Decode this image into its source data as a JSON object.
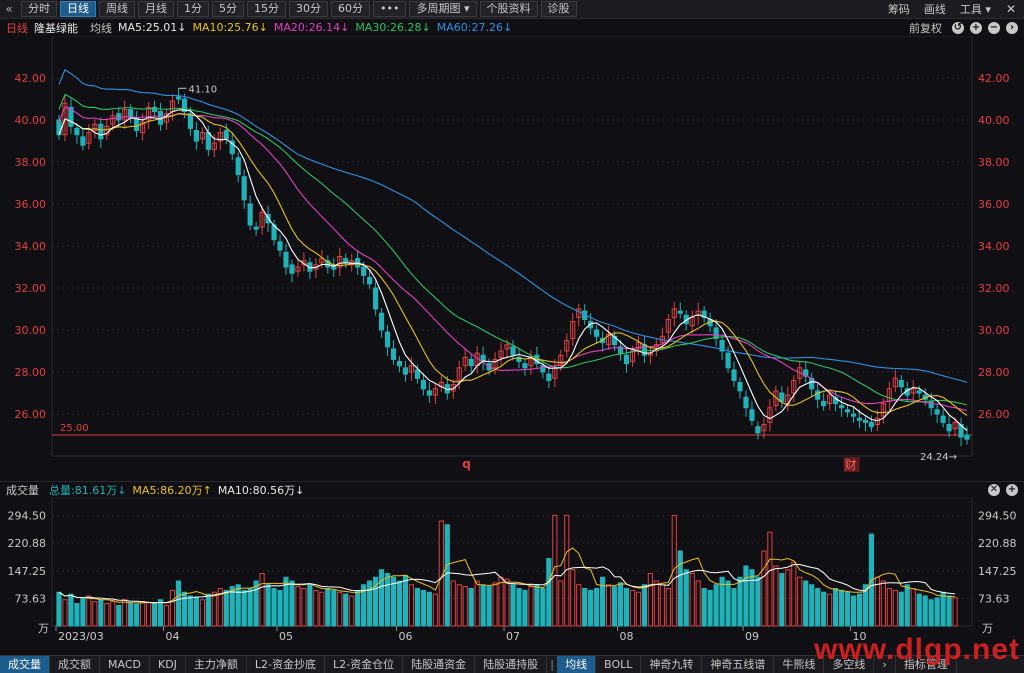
{
  "toolbar": {
    "back_icon": "«",
    "periods": [
      "分时",
      "日线",
      "周线",
      "月线",
      "1分",
      "5分",
      "15分",
      "30分",
      "60分",
      "•••",
      "多周期图 ▾",
      "个股资料",
      "诊股"
    ],
    "active_period": "日线",
    "right": [
      "筹码",
      "画线",
      "工具 ▾"
    ],
    "close_icon": "✕"
  },
  "header": {
    "period": "日线",
    "stock_name": "隆基绿能",
    "ma_label": "均线",
    "ma5": "MA5:25.01↓",
    "ma10": "MA10:25.76↓",
    "ma20": "MA20:26.14↓",
    "ma30": "MA30:26.28↓",
    "ma60": "MA60:27.26↓",
    "adjust": "前复权",
    "icons": [
      "↺",
      "+",
      "−",
      "›"
    ]
  },
  "colors": {
    "up": "#e04040",
    "down": "#20b2b8",
    "ma5": "#ffffff",
    "ma10": "#e8c020",
    "ma20": "#e040c0",
    "ma30": "#30c060",
    "ma60": "#3090e0",
    "price_axis": "#e04040"
  },
  "price_axis": {
    "ticks": [
      "42.00",
      "40.00",
      "38.00",
      "36.00",
      "34.00",
      "32.00",
      "30.00",
      "28.00",
      "26.00"
    ]
  },
  "annotations": {
    "high": "41.10",
    "low": "24.24→",
    "ref_line": "25.00",
    "marker_q": "q",
    "marker_cai": "财"
  },
  "volume_header": {
    "title": "成交量",
    "total": "总量:81.61万↓",
    "ma5": "MA5:86.20万↑",
    "ma10": "MA10:80.56万↓",
    "icons": [
      "✕",
      "+"
    ]
  },
  "volume_axis": {
    "ticks": [
      "294.50",
      "220.88",
      "147.25",
      "73.63"
    ],
    "unit": "万"
  },
  "x_axis": {
    "labels": [
      "2023/03",
      "04",
      "05",
      "06",
      "07",
      "08",
      "09",
      "10"
    ]
  },
  "bottom_tabs": {
    "left": [
      "成交量",
      "成交额",
      "MACD",
      "KDJ",
      "主力净额",
      "L2-资金抄底",
      "L2-资金仓位",
      "陆股通资金",
      "陆股通持股"
    ],
    "left_active": "成交量",
    "right": [
      "均线",
      "BOLL",
      "神奇九转",
      "神奇五线谱",
      "牛熊线",
      "多空线"
    ],
    "right_active": "均线",
    "arrow": "›",
    "last": "指标管理"
  },
  "watermark": "www.dlgp.net",
  "chart_data": {
    "type": "candlestick",
    "price_ylim": [
      24.0,
      44.0
    ],
    "volume_ylim": [
      0,
      320
    ],
    "closes": [
      39.3,
      40.8,
      39.7,
      39.3,
      38.8,
      39.4,
      39.8,
      39.1,
      39.7,
      40.2,
      40.0,
      40.5,
      40.1,
      39.5,
      39.9,
      40.6,
      40.4,
      39.8,
      40.3,
      40.9,
      41.0,
      40.4,
      39.6,
      39.0,
      39.4,
      38.6,
      38.9,
      39.4,
      39.1,
      38.4,
      37.4,
      36.2,
      35.0,
      34.8,
      35.6,
      35.1,
      34.3,
      33.8,
      33.0,
      32.7,
      33.0,
      33.3,
      32.8,
      33.1,
      33.4,
      33.0,
      32.9,
      33.5,
      33.2,
      33.3,
      33.0,
      32.6,
      32.2,
      31.0,
      30.0,
      29.2,
      28.6,
      28.3,
      27.9,
      28.3,
      27.7,
      27.2,
      26.9,
      27.2,
      27.5,
      27.0,
      27.4,
      28.2,
      28.7,
      28.3,
      28.9,
      28.5,
      28.1,
      28.6,
      29.0,
      29.3,
      28.8,
      28.5,
      28.2,
      28.7,
      28.4,
      28.0,
      27.6,
      28.2,
      28.8,
      29.5,
      30.4,
      31.0,
      30.5,
      30.1,
      29.7,
      29.4,
      29.8,
      29.3,
      28.9,
      28.4,
      29.0,
      29.4,
      28.8,
      28.9,
      29.3,
      29.7,
      30.5,
      31.0,
      30.8,
      30.3,
      30.6,
      30.9,
      30.6,
      30.2,
      29.6,
      29.0,
      28.2,
      27.6,
      27.1,
      26.3,
      25.7,
      25.1,
      25.5,
      26.3,
      27.1,
      26.6,
      26.9,
      27.6,
      28.2,
      27.8,
      27.2,
      26.7,
      26.4,
      26.9,
      26.5,
      26.3,
      26.1,
      25.9,
      25.7,
      25.6,
      25.4,
      25.8,
      26.5,
      27.2,
      27.7,
      27.3,
      26.9,
      27.2,
      27.0,
      26.7,
      26.3,
      26.0,
      25.6,
      25.2,
      25.6,
      24.9,
      24.8
    ],
    "opens": [
      40.0,
      39.3,
      40.6,
      39.6,
      39.2,
      38.9,
      39.5,
      39.8,
      39.3,
      39.8,
      40.3,
      40.0,
      40.5,
      40.1,
      39.4,
      40.0,
      40.6,
      40.4,
      39.9,
      40.4,
      41.1,
      41.0,
      40.3,
      39.5,
      39.1,
      39.4,
      38.6,
      39.0,
      39.5,
      39.0,
      38.2,
      37.3,
      36.0,
      34.9,
      34.9,
      35.5,
      35.0,
      34.2,
      33.7,
      33.1,
      32.8,
      33.1,
      33.2,
      32.9,
      33.2,
      33.3,
      33.1,
      33.0,
      33.4,
      33.1,
      33.4,
      33.0,
      32.5,
      32.0,
      30.8,
      29.9,
      29.1,
      28.5,
      28.2,
      28.0,
      28.1,
      27.6,
      27.1,
      26.9,
      27.3,
      27.4,
      27.1,
      27.6,
      28.3,
      28.6,
      28.3,
      28.8,
      28.4,
      28.2,
      28.7,
      29.1,
      29.2,
      28.7,
      28.4,
      28.3,
      28.8,
      28.3,
      27.9,
      27.7,
      28.3,
      29.0,
      29.6,
      30.6,
      30.9,
      30.4,
      30.0,
      29.6,
      29.3,
      29.7,
      29.2,
      28.8,
      28.5,
      29.1,
      29.3,
      28.8,
      29.0,
      29.4,
      29.9,
      30.6,
      30.9,
      30.7,
      30.2,
      30.7,
      30.9,
      30.5,
      30.1,
      29.5,
      28.9,
      28.1,
      27.5,
      26.8,
      26.2,
      25.4,
      25.2,
      25.6,
      26.4,
      27.0,
      26.5,
      27.0,
      27.7,
      28.1,
      27.7,
      27.1,
      26.6,
      26.5,
      26.8,
      26.4,
      26.2,
      26.0,
      25.8,
      25.7,
      25.6,
      25.5,
      25.9,
      26.6,
      27.3,
      27.6,
      27.2,
      27.0,
      27.1,
      26.9,
      26.6,
      26.2,
      25.9,
      25.5,
      25.3,
      25.5,
      25.0
    ],
    "volumes": [
      90,
      70,
      85,
      60,
      75,
      80,
      65,
      70,
      60,
      65,
      55,
      70,
      60,
      58,
      65,
      62,
      60,
      70,
      55,
      95,
      120,
      90,
      80,
      75,
      70,
      85,
      90,
      100,
      95,
      105,
      110,
      95,
      100,
      120,
      140,
      110,
      100,
      95,
      130,
      120,
      105,
      100,
      110,
      95,
      90,
      100,
      95,
      90,
      85,
      80,
      95,
      110,
      120,
      130,
      150,
      140,
      130,
      120,
      135,
      110,
      100,
      95,
      90,
      85,
      280,
      270,
      120,
      110,
      105,
      100,
      120,
      110,
      105,
      115,
      130,
      125,
      110,
      100,
      95,
      105,
      110,
      100,
      180,
      295,
      120,
      295,
      150,
      110,
      100,
      95,
      100,
      130,
      110,
      105,
      115,
      100,
      95,
      90,
      110,
      140,
      120,
      110,
      100,
      295,
      200,
      150,
      140,
      120,
      100,
      95,
      110,
      130,
      120,
      100,
      130,
      160,
      150,
      130,
      200,
      250,
      160,
      140,
      150,
      170,
      130,
      120,
      110,
      100,
      90,
      85,
      100,
      95,
      90,
      80,
      85,
      110,
      245,
      130,
      120,
      100,
      95,
      90,
      110,
      100,
      85,
      80,
      70,
      75,
      90,
      80,
      75
    ]
  }
}
